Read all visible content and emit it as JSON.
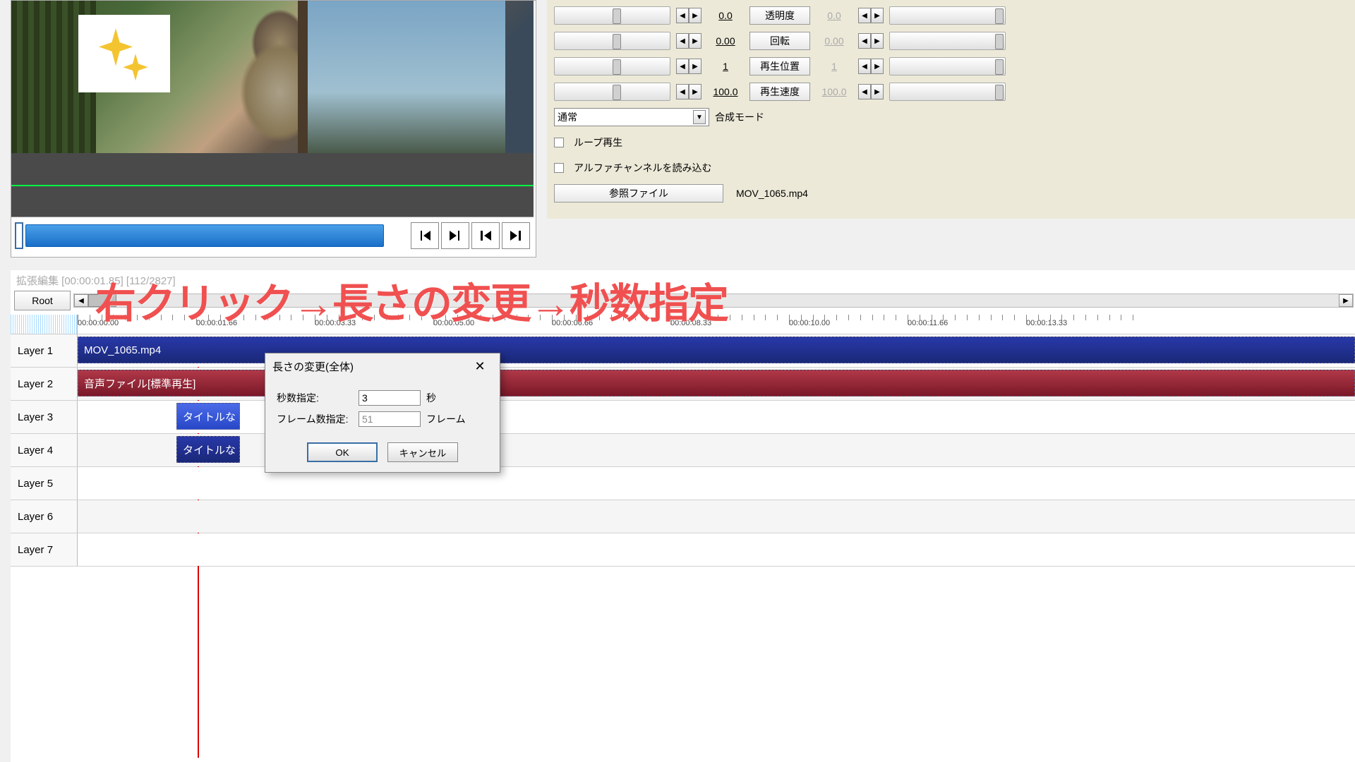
{
  "preview": {
    "sparkle_label": "sparkle"
  },
  "transport": {
    "prev_frame": "prev-frame-icon",
    "next_frame": "next-frame-icon",
    "to_start": "to-start-icon",
    "to_end": "to-end-icon"
  },
  "params": {
    "rows": [
      {
        "label": "透明度",
        "left": "0.0",
        "right": "0.0"
      },
      {
        "label": "回転",
        "left": "0.00",
        "right": "0.00"
      },
      {
        "label": "再生位置",
        "left": "1",
        "right": "1"
      },
      {
        "label": "再生速度",
        "left": "100.0",
        "right": "100.0"
      }
    ],
    "blend_label": "合成モード",
    "blend_selected": "通常",
    "loop_label": "ループ再生",
    "alpha_label": "アルファチャンネルを読み込む",
    "ref_btn": "参照ファイル",
    "ref_file": "MOV_1065.mp4"
  },
  "timeline": {
    "title": "拡張編集 [00:00:01.85] [112/2827]",
    "root": "Root",
    "ruler": [
      "00:00:00.00",
      "00:00:01.66",
      "00:00:03.33",
      "00:00:05.00",
      "00:00:06.66",
      "00:00:08.33",
      "00:00:10.00",
      "00:00:11.66",
      "00:00:13.33"
    ],
    "layers": [
      "Layer 1",
      "Layer 2",
      "Layer 3",
      "Layer 4",
      "Layer 5",
      "Layer 6",
      "Layer 7"
    ],
    "clips": {
      "video": "MOV_1065.mp4",
      "audio": "音声ファイル[標準再生]",
      "title1": "タイトルな",
      "title2": "タイトルな"
    }
  },
  "dialog": {
    "title": "長さの変更(全体)",
    "sec_label": "秒数指定:",
    "sec_value": "3",
    "sec_unit": "秒",
    "frame_label": "フレーム数指定:",
    "frame_value": "51",
    "frame_unit": "フレーム",
    "ok": "OK",
    "cancel": "キャンセル"
  },
  "annotation": "右クリック→長さの変更→秒数指定"
}
